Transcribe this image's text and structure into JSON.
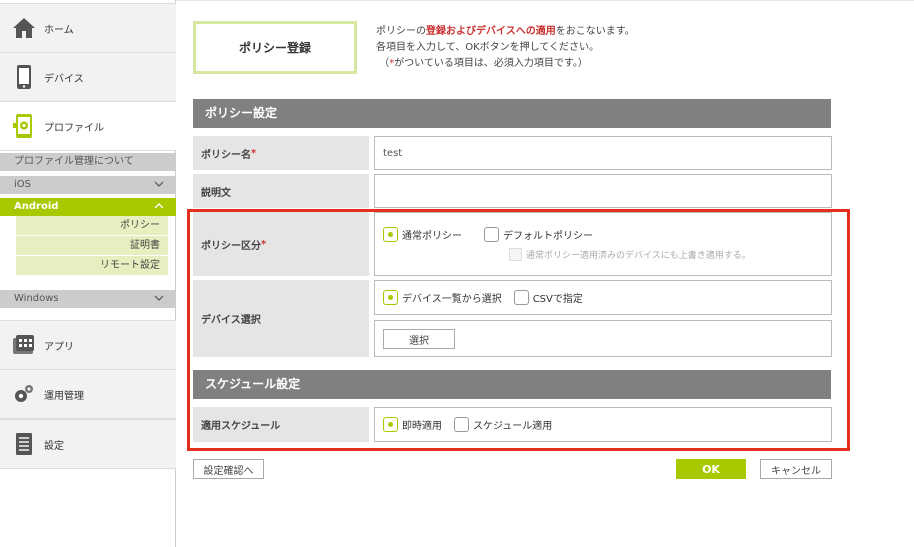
{
  "sidebar": {
    "home": "ホーム",
    "devices": "デバイス",
    "profile": "プロファイル",
    "profile_about": "プロファイル管理について",
    "ios": "iOS",
    "android": "Android",
    "android_items": [
      "ポリシー",
      "証明書",
      "リモート設定"
    ],
    "windows": "Windows",
    "apps": "アプリ",
    "operations": "運用管理",
    "settings": "設定"
  },
  "page": {
    "title": "ポリシー登録",
    "desc_line1_pre": "ポリシーの",
    "desc_line1_hl": "登録およびデバイスへの適用",
    "desc_line1_post": "をおこないます。",
    "desc_line2": "各項目を入力して、OKボタンを押してください。",
    "desc_line3_pre": "（",
    "desc_line3_ast": "*",
    "desc_line3_post": "がついている項目は、必須入力項目です。）"
  },
  "policy_section": {
    "header": "ポリシー設定",
    "name_label": "ポリシー名",
    "name_value": "test",
    "desc_label": "説明文",
    "desc_value": "",
    "kind_label": "ポリシー区分",
    "kind_opt_normal": "通常ポリシー",
    "kind_opt_default": "デフォルトポリシー",
    "overwrite_label": "通常ポリシー適用済みのデバイスにも上書き適用する。",
    "device_label": "デバイス選択",
    "device_opt_list": "デバイス一覧から選択",
    "device_opt_csv": "CSVで指定",
    "select_button": "選択"
  },
  "schedule_section": {
    "header": "スケジュール設定",
    "apply_label": "適用スケジュール",
    "opt_immediate": "即時適用",
    "opt_schedule": "スケジュール適用"
  },
  "footer": {
    "confirm_button": "設定確認へ",
    "ok_button": "OK",
    "cancel_button": "キャンセル"
  },
  "required_mark": "*",
  "colors": {
    "accent": "#a8c800",
    "highlight": "#e62e1e",
    "section_header": "#808080"
  }
}
